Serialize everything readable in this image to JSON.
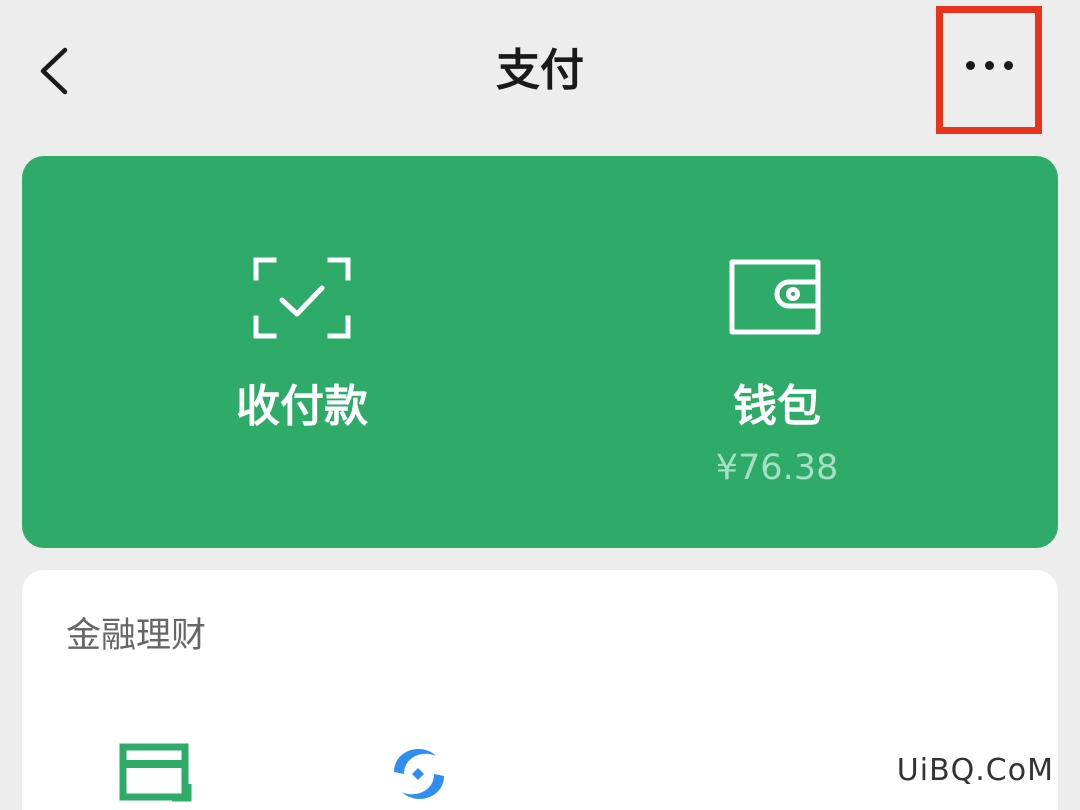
{
  "header": {
    "title": "支付",
    "back_icon": "chevron-left-icon",
    "more_icon": "more-horizontal-icon",
    "highlight_color": "#e8341c"
  },
  "pay_card": {
    "background": "#2eab69",
    "actions": [
      {
        "label": "收付款",
        "icon": "scan-check-icon"
      },
      {
        "label": "钱包",
        "icon": "wallet-icon",
        "balance": "¥76.38"
      }
    ]
  },
  "finance": {
    "section_title": "金融理财",
    "items": [
      {
        "icon": "credit-card-icon",
        "color": "#2eab69"
      },
      {
        "icon": "wealth-icon",
        "color": "#2f8ef0"
      }
    ]
  },
  "watermark": "UiBQ.CoM"
}
